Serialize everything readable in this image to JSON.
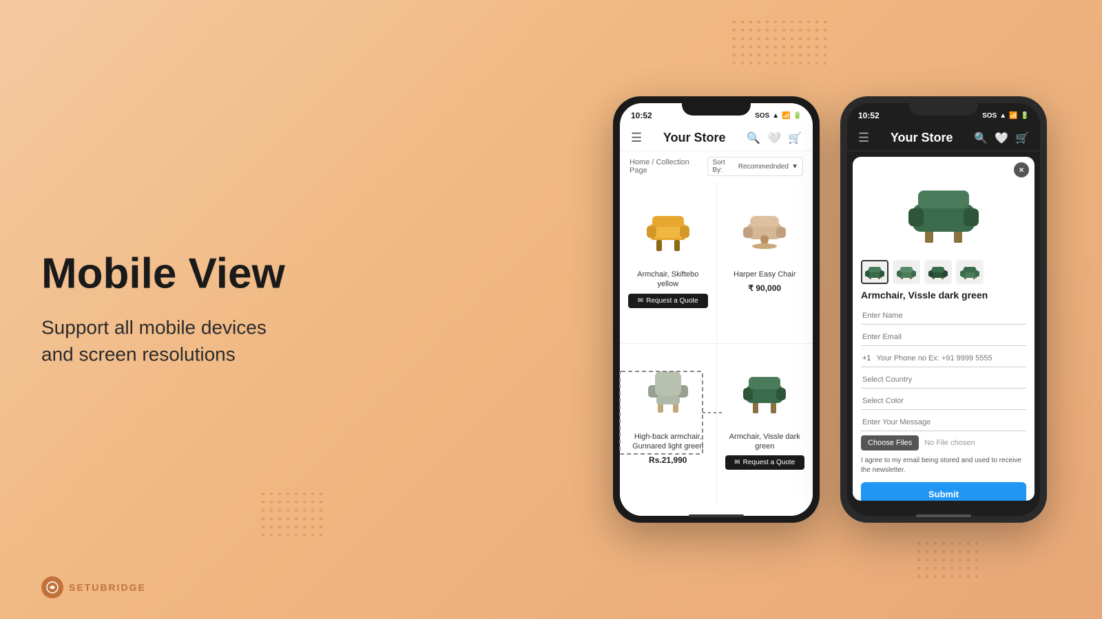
{
  "page": {
    "background_gradient": "linear-gradient(135deg, #f5c9a0, #e8a878)",
    "title": "Mobile View",
    "subtitle_line1": "Support all mobile devices",
    "subtitle_line2": "and screen resolutions"
  },
  "logo": {
    "text": "SETUBRIDGE"
  },
  "phone1": {
    "time": "10:52",
    "status_icons": "SOS ▲ 📶 🔋",
    "store_name": "Your Store",
    "breadcrumb": "Home / Collection Page",
    "sort_label": "Sort By:",
    "sort_value": "Recommednded",
    "products": [
      {
        "name": "Armchair, Skiftebo yellow",
        "price": "",
        "has_button": true,
        "button_label": "Request a Quote",
        "color": "yellow"
      },
      {
        "name": "Harper Easy Chair",
        "price": "₹ 90,000",
        "has_button": false,
        "color": "beige"
      },
      {
        "name": "High-back armchair, Gunnared light green",
        "price": "Rs.21,990",
        "has_button": false,
        "color": "lightgray"
      },
      {
        "name": "Armchair, Vissle dark green",
        "price": "",
        "has_button": true,
        "button_label": "Request a Quote",
        "color": "darkgreen"
      }
    ]
  },
  "phone2": {
    "time": "10:52",
    "store_name": "Your Store",
    "product": {
      "name": "Armchair, Vissle dark green",
      "thumbnails": [
        "thumb1",
        "thumb2",
        "thumb3",
        "thumb4"
      ]
    },
    "form": {
      "name_placeholder": "Enter Name",
      "email_placeholder": "Enter Email",
      "phone_code": "+1",
      "phone_placeholder": "Your Phone no Ex: +91 9999 5555",
      "country_placeholder": "Select Country",
      "color_placeholder": "Select Color",
      "message_placeholder": "Enter Your Message",
      "choose_files_label": "Choose Files",
      "no_file_text": "No File chosen",
      "consent_text": "I agree to my email being stored and used to receive the newsletter.",
      "submit_label": "Submit"
    },
    "close_label": "×"
  }
}
